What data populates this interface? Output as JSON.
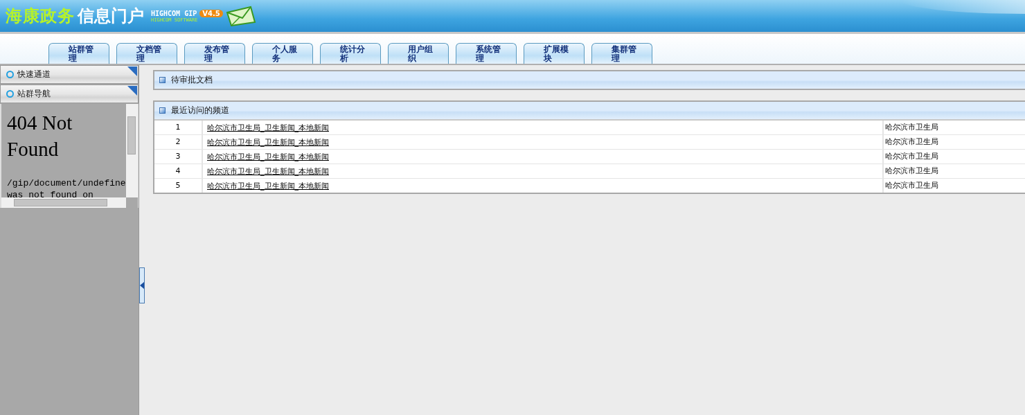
{
  "header": {
    "logo_primary": "海康政务",
    "logo_secondary": "信息门户",
    "brand": "HIGHCOM GIP",
    "version": "V4.5",
    "brand_sub": "HIGHCOM SOFTWARE"
  },
  "tabs": [
    {
      "label": "站群管理"
    },
    {
      "label": "文档管理"
    },
    {
      "label": "发布管理"
    },
    {
      "label": "个人服务"
    },
    {
      "label": "统计分析"
    },
    {
      "label": "用户组织"
    },
    {
      "label": "系统管理"
    },
    {
      "label": "扩展模块"
    },
    {
      "label": "集群管理"
    }
  ],
  "sidebar": {
    "sections": [
      {
        "label": "快速通道"
      },
      {
        "label": "站群导航"
      }
    ],
    "frame": {
      "heading": "404 Not Found",
      "path": "/gip/document/undefine",
      "message": "was not found on"
    }
  },
  "panels": [
    {
      "title": "待审批文档"
    },
    {
      "title": "最近访问的频道",
      "rows": [
        {
          "index": "1",
          "channel": "哈尔滨市卫生局_卫生新闻_本地新闻",
          "site": "哈尔滨市卫生局"
        },
        {
          "index": "2",
          "channel": "哈尔滨市卫生局_卫生新闻_本地新闻",
          "site": "哈尔滨市卫生局"
        },
        {
          "index": "3",
          "channel": "哈尔滨市卫生局_卫生新闻_本地新闻",
          "site": "哈尔滨市卫生局"
        },
        {
          "index": "4",
          "channel": "哈尔滨市卫生局_卫生新闻_本地新闻",
          "site": "哈尔滨市卫生局"
        },
        {
          "index": "5",
          "channel": "哈尔滨市卫生局_卫生新闻_本地新闻",
          "site": "哈尔滨市卫生局"
        }
      ]
    }
  ]
}
